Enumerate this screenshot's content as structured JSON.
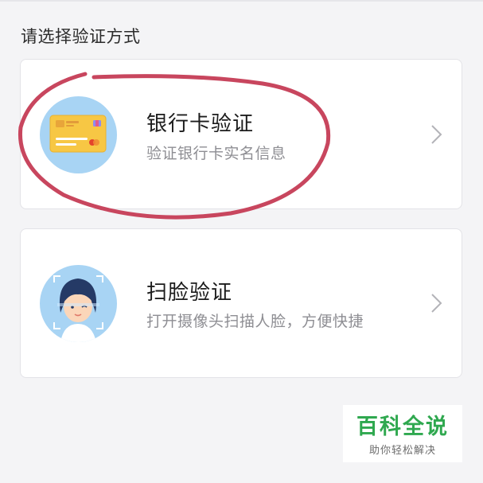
{
  "header": {
    "section_title": "请选择验证方式"
  },
  "options": [
    {
      "title": "银行卡验证",
      "description": "验证银行卡实名信息",
      "icon": "bank-card-icon"
    },
    {
      "title": "扫脸验证",
      "description": "打开摄像头扫描人脸，方便快捷",
      "icon": "face-scan-icon"
    }
  ],
  "watermark": {
    "title": "百科全说",
    "subtitle": "助你轻松解决"
  },
  "colors": {
    "background": "#f4f4f6",
    "card": "#ffffff",
    "icon_circle": "#a8d4f4",
    "annotation_ink": "#c8465e",
    "watermark_green": "#2fa84f"
  }
}
